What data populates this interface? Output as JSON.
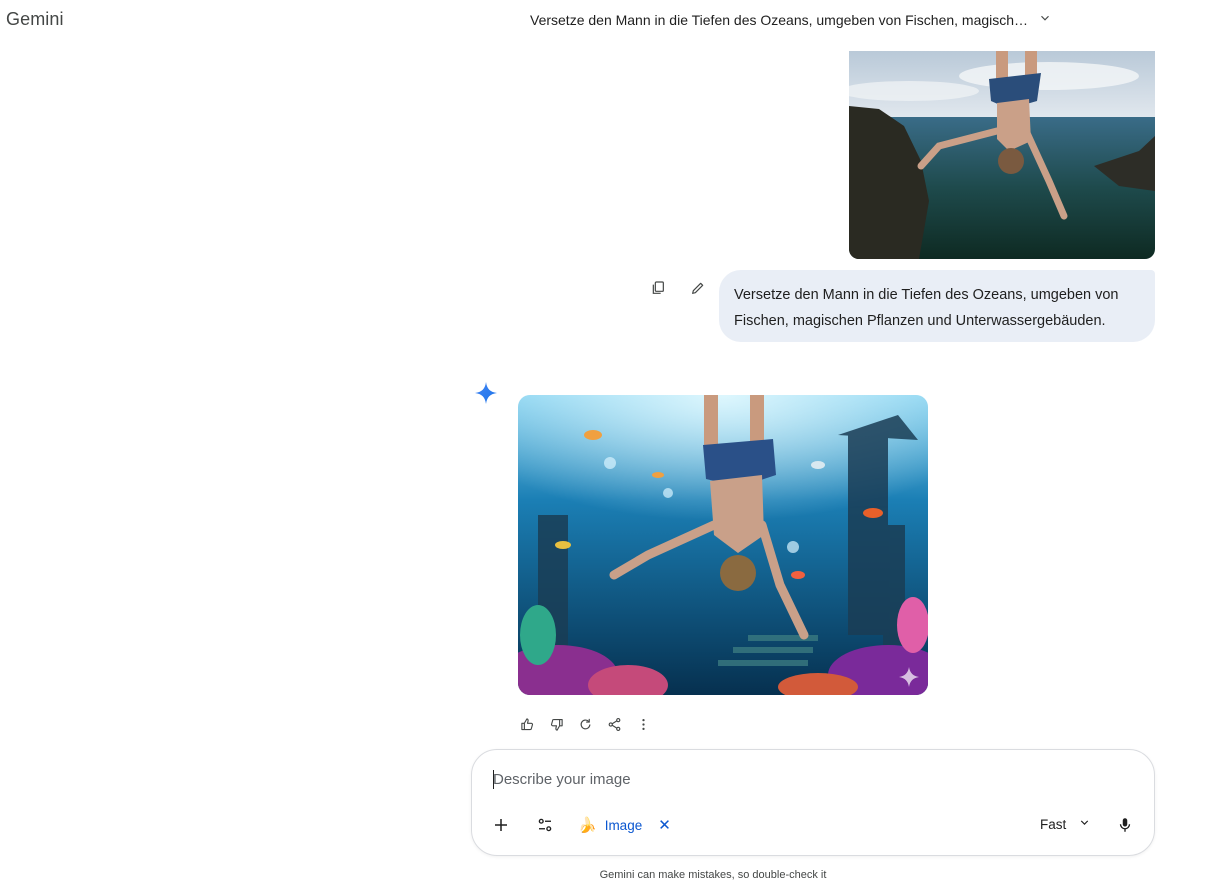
{
  "app": {
    "title": "Gemini"
  },
  "conversation": {
    "title": "Versetze den Mann in die Tiefen des Ozeans, umgeben von Fischen, magisch…"
  },
  "user_message": {
    "line1": "Versetze den Mann in die Tiefen des Ozeans, umgeben von",
    "line2": "Fischen, magischen Pflanzen und Unterwassergebäuden.",
    "actions": [
      "copy-icon",
      "edit-icon"
    ]
  },
  "response": {
    "actions": [
      "thumb-up-icon",
      "thumb-down-icon",
      "regenerate-icon",
      "share-icon",
      "more-vert-icon"
    ]
  },
  "composer": {
    "placeholder": "Describe your image",
    "value": "",
    "chip_label": "Image",
    "chip_emoji": "🍌",
    "mode": "Fast"
  },
  "footer": {
    "disclaimer": "Gemini can make mistakes, so double-check it"
  },
  "colors": {
    "accent": "#0b57d0",
    "bubble": "#e9eef6",
    "gemini_star": "#4285f4"
  }
}
